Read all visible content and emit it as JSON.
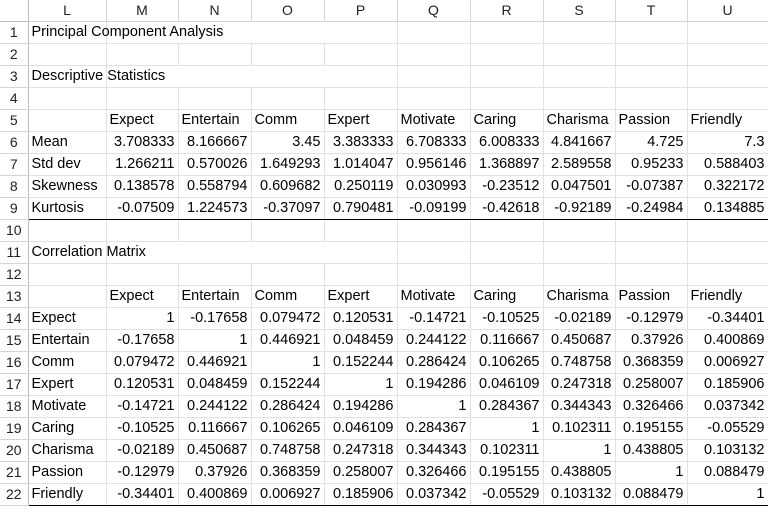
{
  "columns": [
    "L",
    "M",
    "N",
    "O",
    "P",
    "Q",
    "R",
    "S",
    "T",
    "U"
  ],
  "title": "Principal Component Analysis",
  "descriptive_title": "Descriptive Statistics",
  "correlation_title": "Correlation Matrix",
  "variables": [
    "Expect",
    "Entertain",
    "Comm",
    "Expert",
    "Motivate",
    "Caring",
    "Charisma",
    "Passion",
    "Friendly"
  ],
  "descriptive_stats": [
    {
      "label": "Mean",
      "values": [
        "3.708333",
        "8.166667",
        "3.45",
        "3.383333",
        "6.708333",
        "6.008333",
        "4.841667",
        "4.725",
        "7.3"
      ]
    },
    {
      "label": "Std dev",
      "values": [
        "1.266211",
        "0.570026",
        "1.649293",
        "1.014047",
        "0.956146",
        "1.368897",
        "2.589558",
        "0.95233",
        "0.588403"
      ]
    },
    {
      "label": "Skewness",
      "values": [
        "0.138578",
        "0.558794",
        "0.609682",
        "0.250119",
        "0.030993",
        "-0.23512",
        "0.047501",
        "-0.07387",
        "0.322172"
      ]
    },
    {
      "label": "Kurtosis",
      "values": [
        "-0.07509",
        "1.224573",
        "-0.37097",
        "0.790481",
        "-0.09199",
        "-0.42618",
        "-0.92189",
        "-0.24984",
        "0.134885"
      ]
    }
  ],
  "correlation_matrix": [
    {
      "label": "Expect",
      "values": [
        "1",
        "-0.17658",
        "0.079472",
        "0.120531",
        "-0.14721",
        "-0.10525",
        "-0.02189",
        "-0.12979",
        "-0.34401"
      ]
    },
    {
      "label": "Entertain",
      "values": [
        "-0.17658",
        "1",
        "0.446921",
        "0.048459",
        "0.244122",
        "0.116667",
        "0.450687",
        "0.37926",
        "0.400869"
      ]
    },
    {
      "label": "Comm",
      "values": [
        "0.079472",
        "0.446921",
        "1",
        "0.152244",
        "0.286424",
        "0.106265",
        "0.748758",
        "0.368359",
        "0.006927"
      ]
    },
    {
      "label": "Expert",
      "values": [
        "0.120531",
        "0.048459",
        "0.152244",
        "1",
        "0.194286",
        "0.046109",
        "0.247318",
        "0.258007",
        "0.185906"
      ]
    },
    {
      "label": "Motivate",
      "values": [
        "-0.14721",
        "0.244122",
        "0.286424",
        "0.194286",
        "1",
        "0.284367",
        "0.344343",
        "0.326466",
        "0.037342"
      ]
    },
    {
      "label": "Caring",
      "values": [
        "-0.10525",
        "0.116667",
        "0.106265",
        "0.046109",
        "0.284367",
        "1",
        "0.102311",
        "0.195155",
        "-0.05529"
      ]
    },
    {
      "label": "Charisma",
      "values": [
        "-0.02189",
        "0.450687",
        "0.748758",
        "0.247318",
        "0.344343",
        "0.102311",
        "1",
        "0.438805",
        "0.103132"
      ]
    },
    {
      "label": "Passion",
      "values": [
        "-0.12979",
        "0.37926",
        "0.368359",
        "0.258007",
        "0.326466",
        "0.195155",
        "0.438805",
        "1",
        "0.088479"
      ]
    },
    {
      "label": "Friendly",
      "values": [
        "-0.34401",
        "0.400869",
        "0.006927",
        "0.185906",
        "0.037342",
        "-0.05529",
        "0.103132",
        "0.088479",
        "1"
      ]
    }
  ]
}
